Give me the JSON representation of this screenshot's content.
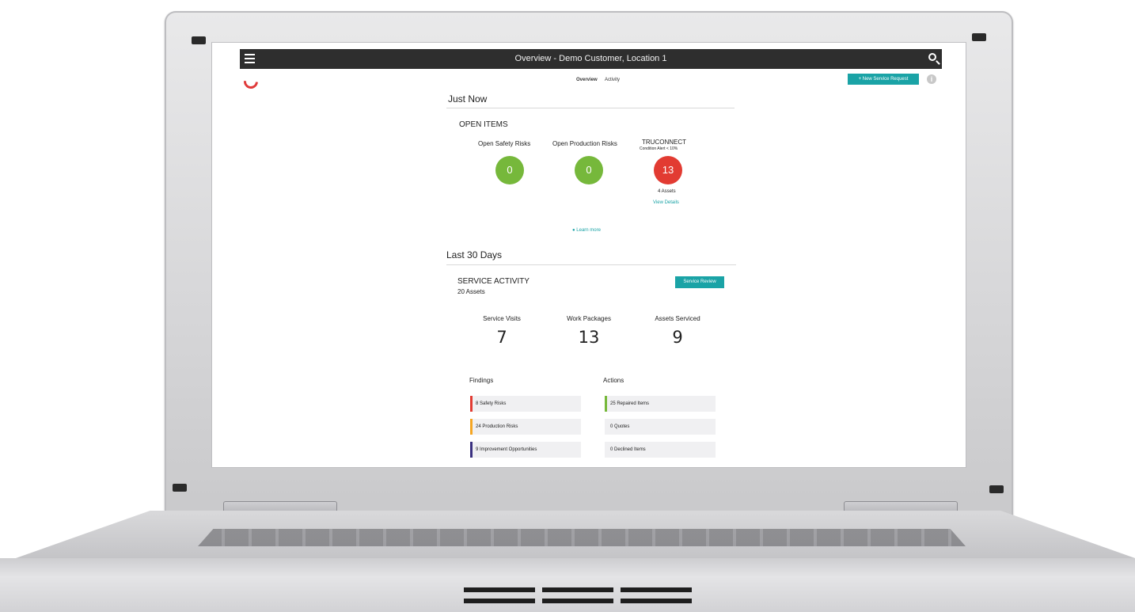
{
  "app": {
    "title": "Overview - Demo Customer, Location 1"
  },
  "tabs": [
    "Overview",
    "Activity"
  ],
  "new_service_request": "+ New Service Request",
  "just_now": {
    "title": "Just Now",
    "open_items_title": "OPEN ITEMS",
    "safety_label": "Open Safety Risks",
    "safety_value": "0",
    "production_label": "Open Production Risks",
    "production_value": "0",
    "truconnect_label": "TRUCONNECT",
    "truconnect_sub": "Condition Alert < 10%",
    "truconnect_value": "13",
    "assets": "4 Assets",
    "view_details": "View Details",
    "learn_more": "Learn more"
  },
  "last_30": {
    "title": "Last 30 Days",
    "service_activity": "SERVICE ACTIVITY",
    "assets": "20 Assets",
    "service_review": "Service Review",
    "visits_label": "Service Visits",
    "visits_value": "7",
    "packages_label": "Work Packages",
    "packages_value": "13",
    "serviced_label": "Assets Serviced",
    "serviced_value": "9"
  },
  "findings": {
    "title": "Findings",
    "items": [
      "8 Safety Risks",
      "24 Production Risks",
      "9 Improvement Opportunities"
    ]
  },
  "actions": {
    "title": "Actions",
    "items": [
      "25 Repaired Items",
      "0 Quotes",
      "0 Declined Items"
    ]
  },
  "colors": {
    "accent": "#1aa3a6",
    "green": "#76b83b",
    "red": "#e23b32",
    "orange": "#f5a623",
    "purple": "#3a3080"
  }
}
